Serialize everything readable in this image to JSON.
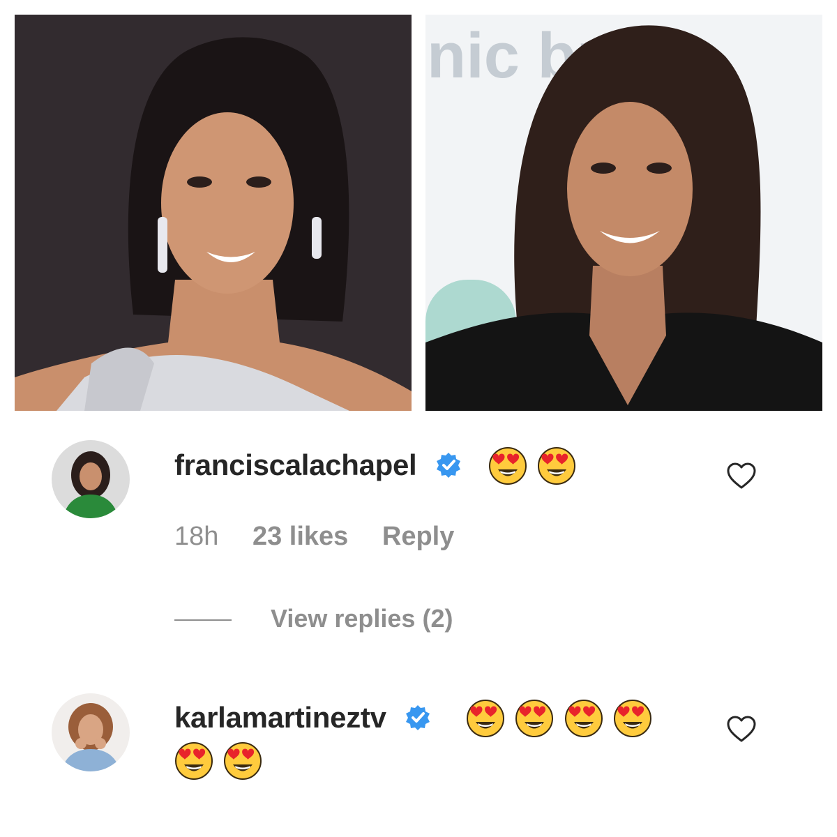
{
  "photos": {
    "left": {
      "name": "left-photo"
    },
    "right": {
      "name": "right-photo",
      "backdrop_text": "nic bran"
    }
  },
  "comments": [
    {
      "username": "franciscalachapel",
      "verified": true,
      "emoji": [
        "heart-eyes-emoji",
        "heart-eyes-emoji"
      ],
      "time": "18h",
      "likes": "23 likes",
      "reply": "Reply",
      "view_replies": "View replies (2)"
    },
    {
      "username": "karlamartineztv",
      "verified": true,
      "emoji": [
        "heart-eyes-emoji",
        "heart-eyes-emoji",
        "heart-eyes-emoji",
        "heart-eyes-emoji",
        "heart-eyes-emoji",
        "heart-eyes-emoji"
      ]
    }
  ],
  "colors": {
    "text_primary": "#262626",
    "text_secondary": "#8e8e8e",
    "verified_blue": "#3897f0",
    "background": "#ffffff"
  }
}
